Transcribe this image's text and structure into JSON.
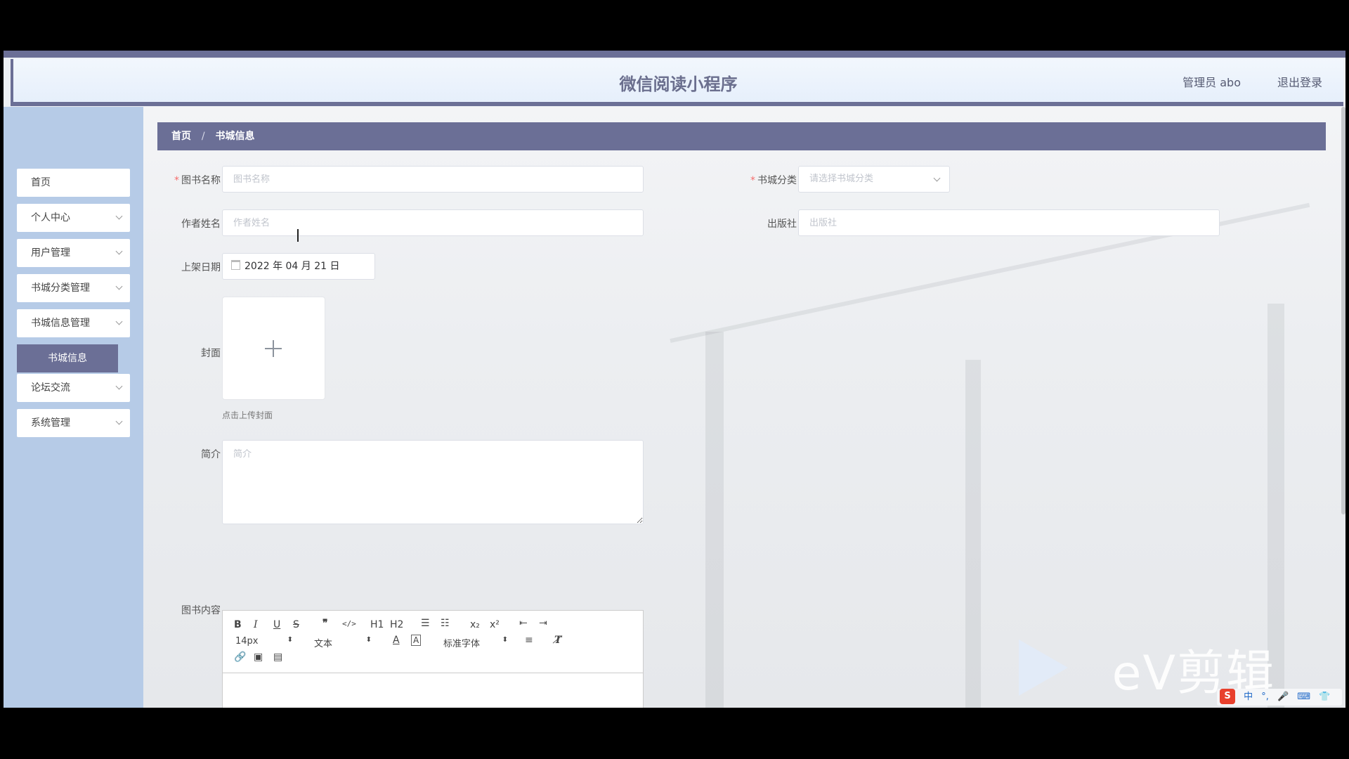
{
  "header": {
    "title": "微信阅读小程序",
    "user": "管理员 abo",
    "logout": "退出登录"
  },
  "sidebar": {
    "items": [
      {
        "label": "首页"
      },
      {
        "label": "个人中心"
      },
      {
        "label": "用户管理"
      },
      {
        "label": "书城分类管理"
      },
      {
        "label": "书城信息管理"
      },
      {
        "label": "论坛交流"
      },
      {
        "label": "系统管理"
      }
    ],
    "active_sub": "书城信息"
  },
  "breadcrumb": {
    "home": "首页",
    "separator": "/",
    "current": "书城信息"
  },
  "form": {
    "book_name": {
      "label": "图书名称",
      "placeholder": "图书名称",
      "required": true
    },
    "category": {
      "label": "书城分类",
      "placeholder": "请选择书城分类",
      "required": true
    },
    "author": {
      "label": "作者姓名",
      "placeholder": "作者姓名"
    },
    "publisher": {
      "label": "出版社",
      "placeholder": "出版社"
    },
    "shelf_date": {
      "label": "上架日期",
      "value": "2022 年 04 月 21 日"
    },
    "cover": {
      "label": "封面",
      "hint": "点击上传封面"
    },
    "intro": {
      "label": "简介",
      "placeholder": "简介"
    },
    "content": {
      "label": "图书内容"
    }
  },
  "editor": {
    "font_size": "14px",
    "heading": "文本",
    "font_family": "标准字体",
    "h1": "H1",
    "h2": "H2",
    "sub": "x₂",
    "sup": "x²"
  },
  "watermark": "eV剪辑",
  "tray": {
    "ime": "中"
  }
}
